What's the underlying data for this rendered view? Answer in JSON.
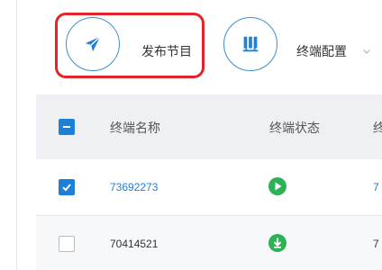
{
  "toolbar": {
    "publish_label": "发布节目",
    "config_label": "终端配置",
    "publish_icon": "send-icon",
    "config_icon": "chart-icon",
    "dropdown_icon": "chevron-down-icon"
  },
  "table": {
    "header": {
      "name": "终端名称",
      "status": "终端状态",
      "next": "终"
    },
    "rows": [
      {
        "name": "73692273",
        "checked": true,
        "status_icon": "play-icon",
        "next": "7"
      },
      {
        "name": "70414521",
        "checked": false,
        "status_icon": "download-icon",
        "next": "7"
      }
    ]
  },
  "colors": {
    "accent": "#1e7fd6",
    "green": "#2db355",
    "highlight": "#e3242b"
  }
}
